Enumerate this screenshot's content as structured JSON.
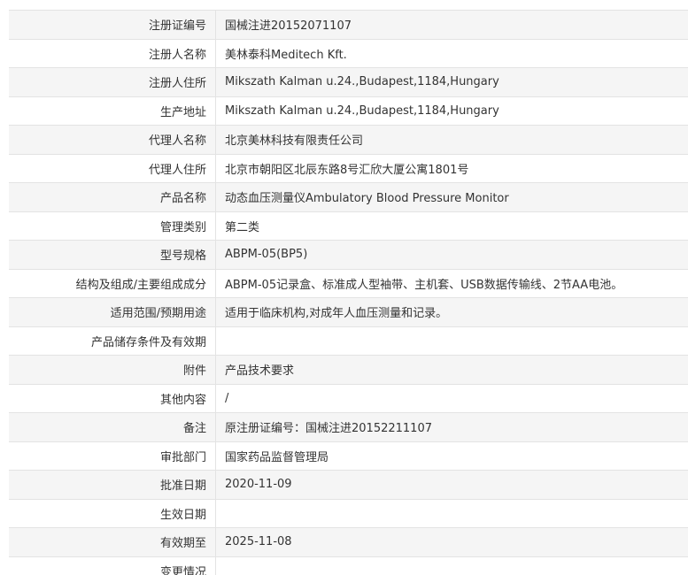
{
  "rows": [
    {
      "label": "注册证编号",
      "value": "国械注进20152071107"
    },
    {
      "label": "注册人名称",
      "value": "美林泰科Meditech Kft."
    },
    {
      "label": "注册人住所",
      "value": "Mikszath Kalman u.24.,Budapest,1184,Hungary"
    },
    {
      "label": "生产地址",
      "value": "Mikszath Kalman u.24.,Budapest,1184,Hungary"
    },
    {
      "label": "代理人名称",
      "value": "北京美林科技有限责任公司"
    },
    {
      "label": "代理人住所",
      "value": "北京市朝阳区北辰东路8号汇欣大厦公寓1801号"
    },
    {
      "label": "产品名称",
      "value": "动态血压测量仪Ambulatory Blood Pressure Monitor"
    },
    {
      "label": "管理类别",
      "value": "第二类"
    },
    {
      "label": "型号规格",
      "value": "ABPM-05(BP5)"
    },
    {
      "label": "结构及组成/主要组成成分",
      "value": "ABPM-05记录盒、标准成人型袖带、主机套、USB数据传输线、2节AA电池。"
    },
    {
      "label": "适用范围/预期用途",
      "value": "适用于临床机构,对成年人血压测量和记录。"
    },
    {
      "label": "产品储存条件及有效期",
      "value": ""
    },
    {
      "label": "附件",
      "value": "产品技术要求"
    },
    {
      "label": "其他内容",
      "value": "/"
    },
    {
      "label": "备注",
      "value": "原注册证编号：国械注进20152211107"
    },
    {
      "label": "审批部门",
      "value": "国家药品监督管理局"
    },
    {
      "label": "批准日期",
      "value": "2020-11-09"
    },
    {
      "label": "生效日期",
      "value": ""
    },
    {
      "label": "有效期至",
      "value": "2025-11-08"
    },
    {
      "label": "变更情况",
      "value": ""
    }
  ]
}
